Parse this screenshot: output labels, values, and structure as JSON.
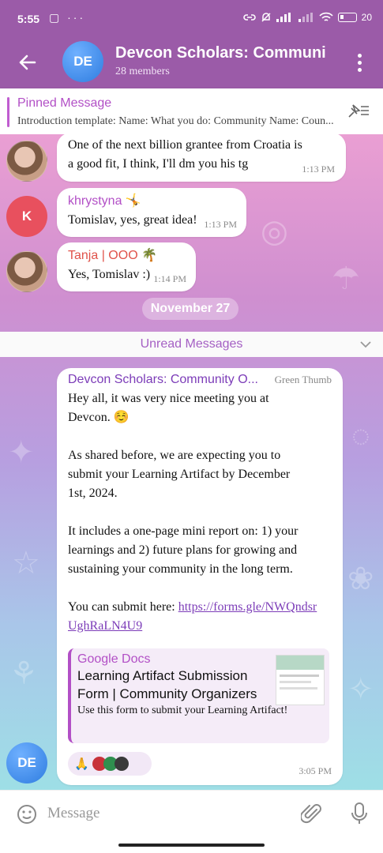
{
  "status_bar": {
    "time": "5:55",
    "left_icons": "▢ ···",
    "battery": "20"
  },
  "header": {
    "avatar_initials": "DE",
    "title": "Devcon Scholars: Communi",
    "subtitle": "28 members"
  },
  "pinned": {
    "label": "Pinned Message",
    "text": "Introduction template:  Name: What you do: Community Name:  Coun..."
  },
  "messages": [
    {
      "text": "One of the next billion grantee from Croatia is a good fit, I think, I'll dm you his tg",
      "time": "1:13 PM"
    },
    {
      "avatar_initials": "K",
      "sender": "khrystyna 🤸",
      "sender_color": "#b24fc6",
      "text": "Tomislav, yes, great idea!",
      "time": "1:13 PM"
    },
    {
      "sender": "Tanja | OOO 🌴",
      "sender_color": "#e0524a",
      "text": "Yes, Tomislav :)",
      "time": "1:14 PM"
    }
  ],
  "date_separator": "November 27",
  "unread_label": "Unread Messages",
  "main_message": {
    "avatar_initials": "DE",
    "sender": "Devcon Scholars: Community O...",
    "sender_color": "#7c3cb8",
    "sender_tag": "Green Thumb",
    "paragraphs": [
      "Hey all, it was very nice meeting you at Devcon. ☺️",
      "As shared before, we are expecting you to submit your Learning Artifact by December 1st, 2024.",
      "It includes a one-page mini report on: 1) your learnings and 2) future plans for growing and sustaining your community in the long term."
    ],
    "submit_prefix": "You can submit here: ",
    "link": "https://forms.gle/NWQndsrUghRaLN4U9",
    "preview": {
      "site": "Google Docs",
      "title": "Learning Artifact Submission Form | Community Organizers",
      "description": "Use this form to submit your Learning Artifact!"
    },
    "reactions": "🙏",
    "time": "3:05 PM"
  },
  "input": {
    "placeholder": "Message"
  },
  "colors": {
    "header": "#9b5ba8",
    "accent": "#b24fc6"
  }
}
